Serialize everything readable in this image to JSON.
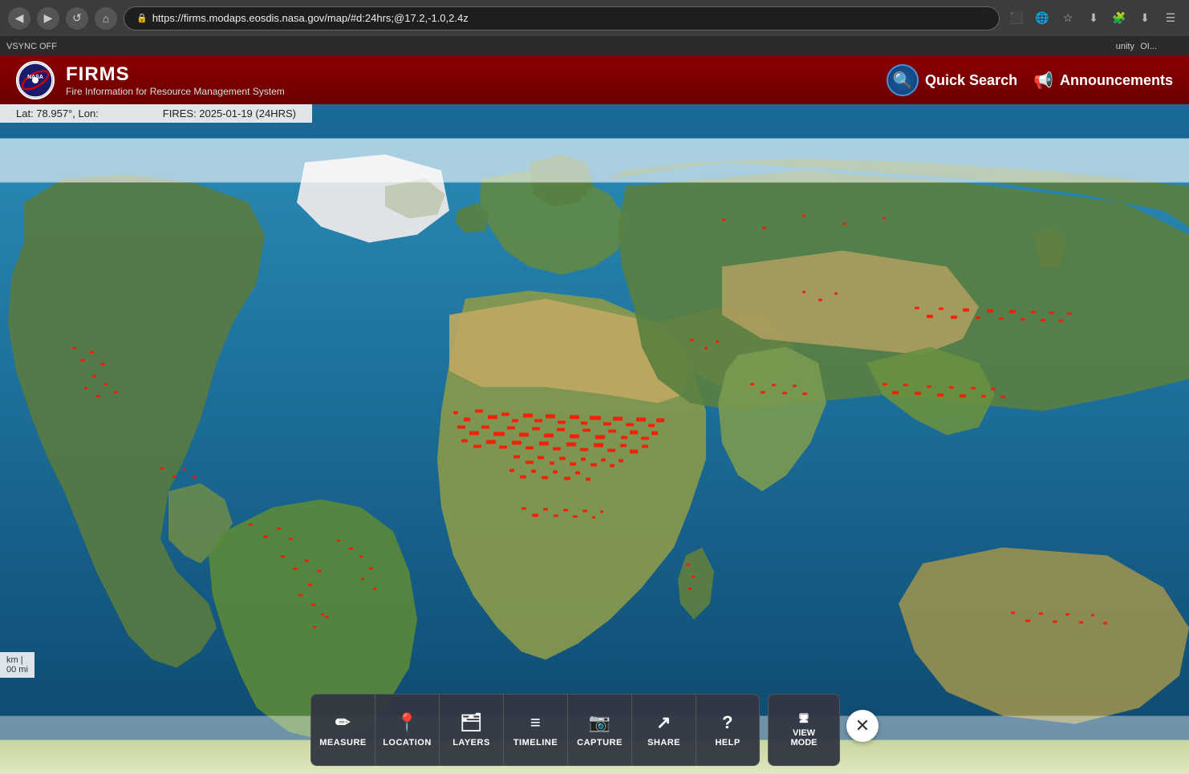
{
  "browser": {
    "url": "https://firms.modaps.eosdis.nasa.gov/map/#d:24hrs;@17.2,-1.0,2.4z",
    "back_icon": "◀",
    "forward_icon": "▶",
    "home_icon": "⌂",
    "reload_icon": "↺"
  },
  "status_bar": {
    "vsync": "VSYNC OFF",
    "community": "unity",
    "ol": "OI..."
  },
  "header": {
    "app_name": "FIRMS",
    "subtitle": "Fire Information for Resource Management System",
    "nasa_label": "NASA",
    "quick_search_label": "Quick Search",
    "announcements_label": "Announcements"
  },
  "coord_bar": {
    "lat_label": "Lat: 78.957°, Lon:",
    "fires_label": "FIRES: 2025-01-19 (24HRS)"
  },
  "scale_bar": {
    "km_label": "km |",
    "mi_label": "00 mi"
  },
  "toolbar": {
    "buttons": [
      {
        "id": "measure",
        "label": "MEASURE",
        "icon": "✏"
      },
      {
        "id": "location",
        "label": "LOCATION",
        "icon": "📍"
      },
      {
        "id": "layers",
        "label": "LAYERS",
        "icon": "🗂"
      },
      {
        "id": "timeline",
        "label": "TIMELINE",
        "icon": "⚙"
      },
      {
        "id": "capture",
        "label": "CAPTURE",
        "icon": "📷"
      },
      {
        "id": "share",
        "label": "SHARE",
        "icon": "↗"
      },
      {
        "id": "help",
        "label": "HELP",
        "icon": "?"
      }
    ],
    "view_mode_label": "VIEW\nMODE",
    "view_mode_icon": "🖥",
    "close_icon": "✕"
  }
}
